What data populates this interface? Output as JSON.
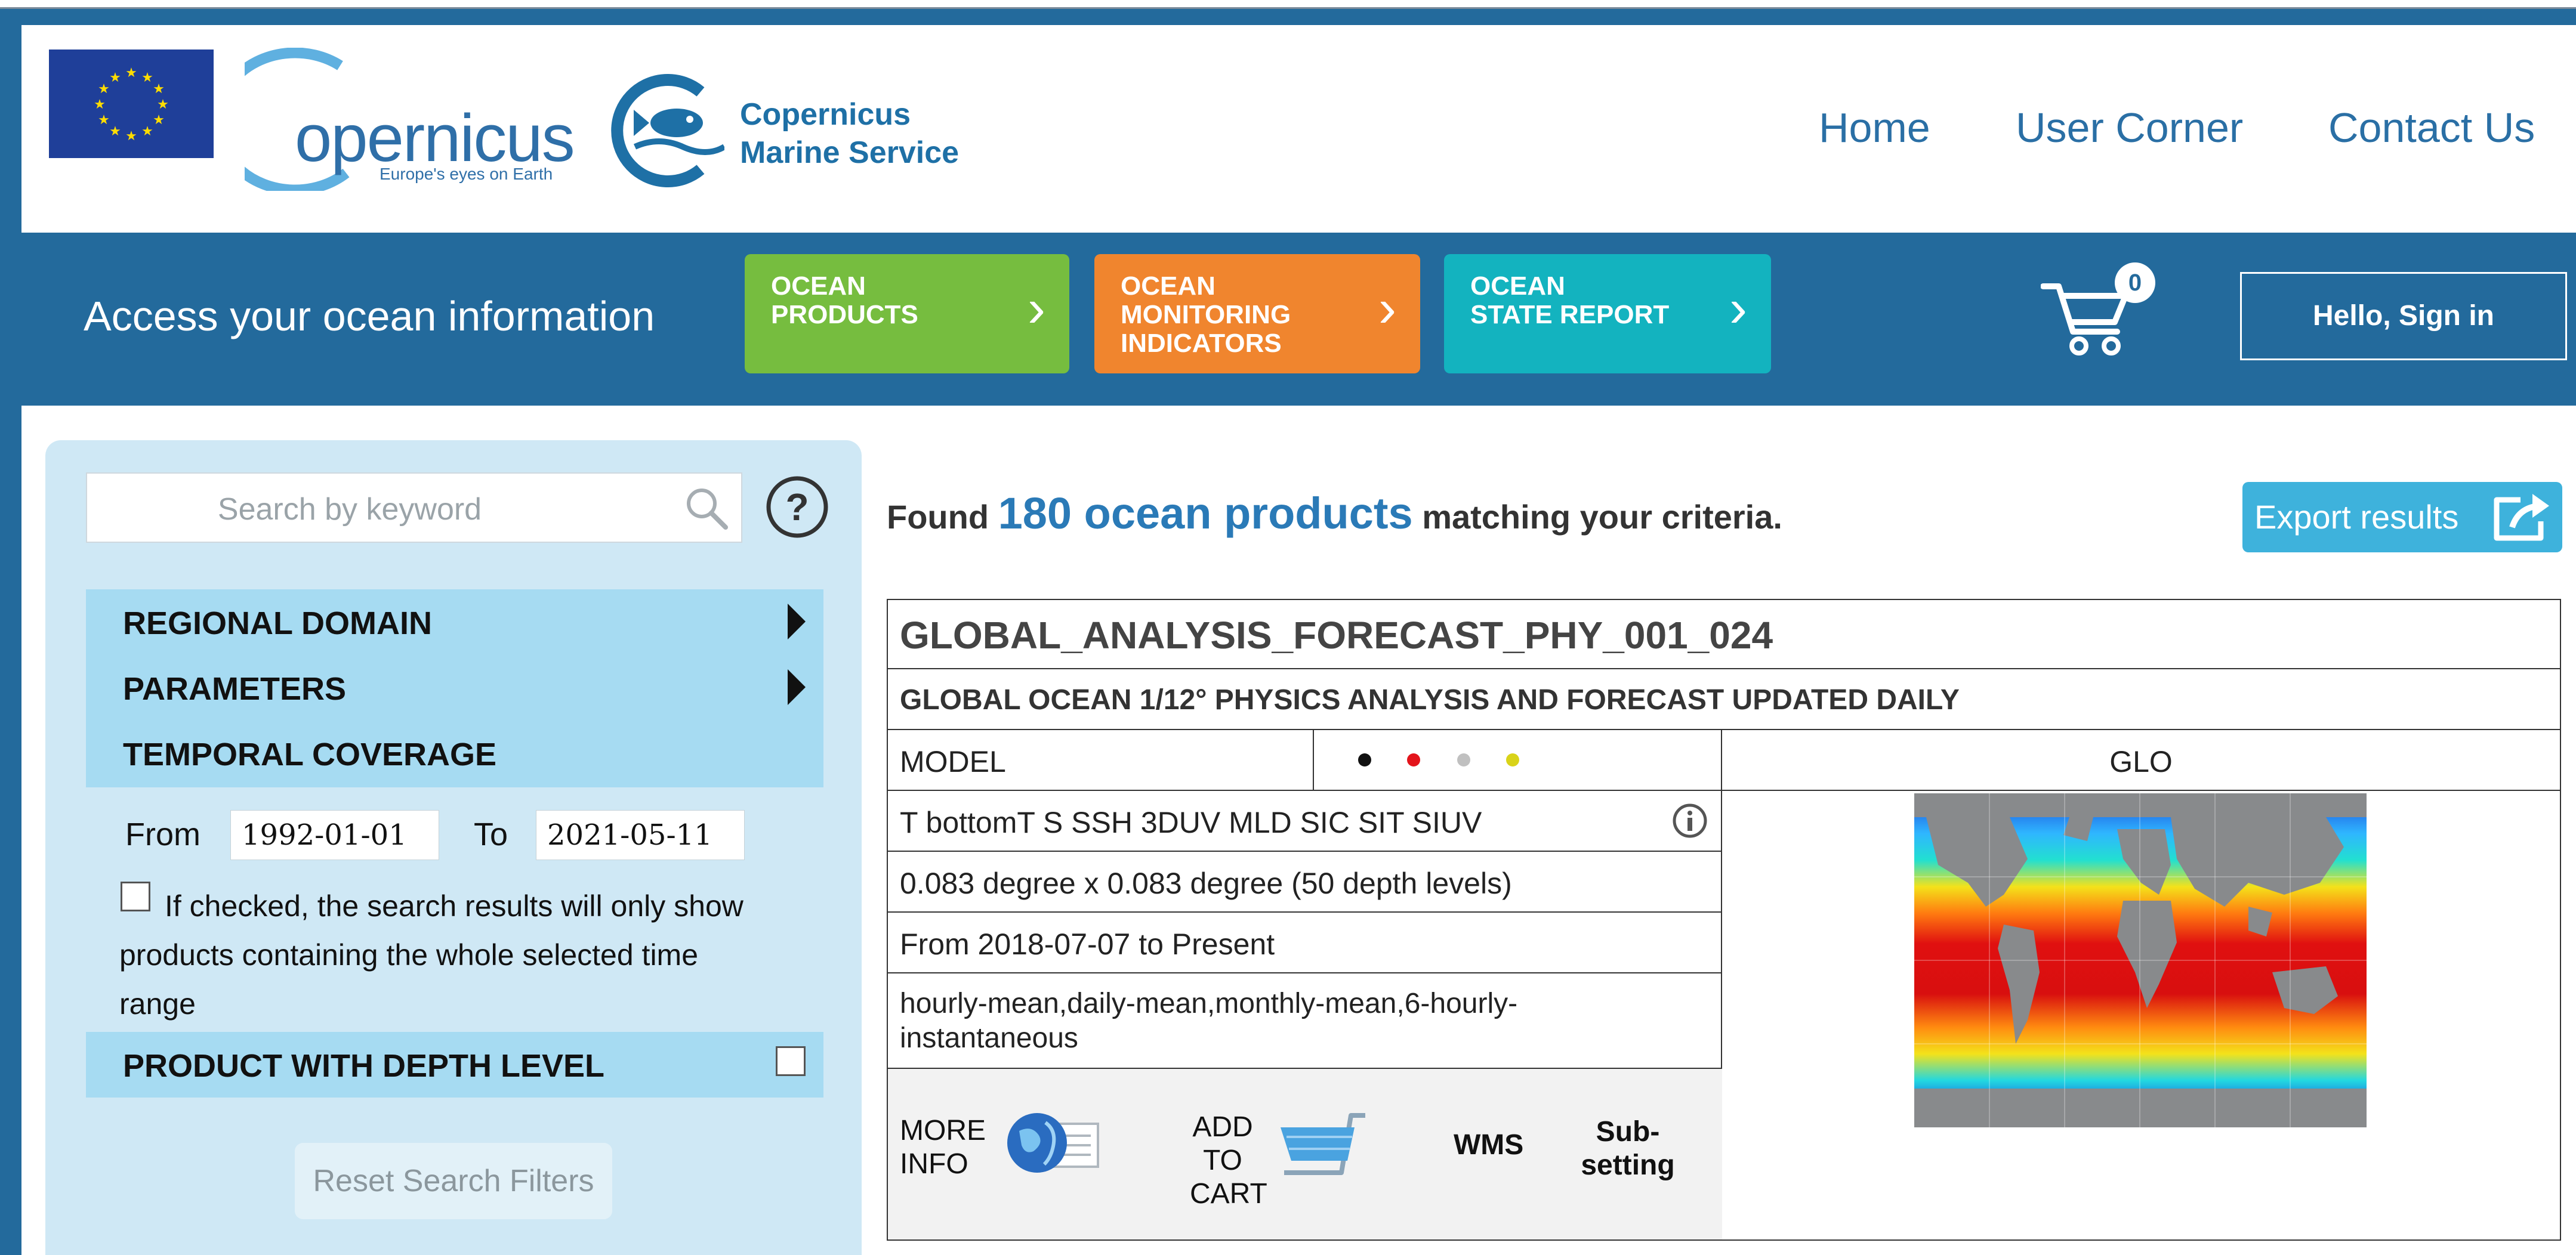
{
  "header": {
    "copernicus_logo_text": "opernicus",
    "copernicus_tagline": "Europe's eyes on Earth",
    "service_name_line1": "Copernicus",
    "service_name_line2": "Marine Service",
    "nav": [
      {
        "label": "Home"
      },
      {
        "label": "User Corner"
      },
      {
        "label": "Contact Us"
      }
    ]
  },
  "band": {
    "tagline": "Access your ocean information",
    "tiles": [
      {
        "line1": "OCEAN",
        "line2": "PRODUCTS",
        "line3": "",
        "color": "#76bd3f"
      },
      {
        "line1": "OCEAN",
        "line2": "MONITORING",
        "line3": "INDICATORS",
        "color": "#f0852e"
      },
      {
        "line1": "OCEAN",
        "line2": "STATE REPORT",
        "line3": "",
        "color": "#13b3bf"
      }
    ],
    "cart_count": "0",
    "signin_label": "Hello, Sign in"
  },
  "sidebar": {
    "search_placeholder": "Search by keyword",
    "sections": {
      "regional_domain": "REGIONAL DOMAIN",
      "parameters": "PARAMETERS",
      "temporal_coverage": "TEMPORAL COVERAGE",
      "depth_level": "PRODUCT WITH DEPTH LEVEL"
    },
    "from_label": "From",
    "from_value": "1992-01-01",
    "to_label": "To",
    "to_value": "2021-05-11",
    "checkbox_line1": "If checked, the search results will only show",
    "checkbox_line2": "products containing the whole selected time",
    "checkbox_line3": "range",
    "reset_label": "Reset Search Filters"
  },
  "results": {
    "found_prefix": "Found",
    "found_count": "180 ocean products",
    "found_suffix": "matching your criteria.",
    "export_label": "Export results"
  },
  "product": {
    "id": "GLOBAL_ANALYSIS_FORECAST_PHY_001_024",
    "title": "GLOBAL OCEAN 1/12° PHYSICS ANALYSIS AND FORECAST UPDATED DAILY",
    "type": "MODEL",
    "dot_colors": [
      "#111111",
      "#e3141b",
      "#c0c0c0",
      "#d9d319"
    ],
    "area": "GLO",
    "variables": "T bottomT S SSH 3DUV MLD SIC SIT SIUV",
    "resolution": "0.083 degree x 0.083 degree (50 depth levels)",
    "coverage": "From 2018-07-07 to Present",
    "frequency_line1": "hourly-mean,daily-mean,monthly-mean,6-hourly-",
    "frequency_line2": "instantaneous",
    "actions": {
      "more_info_line1": "MORE",
      "more_info_line2": "INFO",
      "add_cart_line1": "ADD",
      "add_cart_line2": "TO",
      "add_cart_line3": "CART",
      "wms": "WMS",
      "subsetting_line1": "Sub-",
      "subsetting_line2": "setting"
    }
  }
}
